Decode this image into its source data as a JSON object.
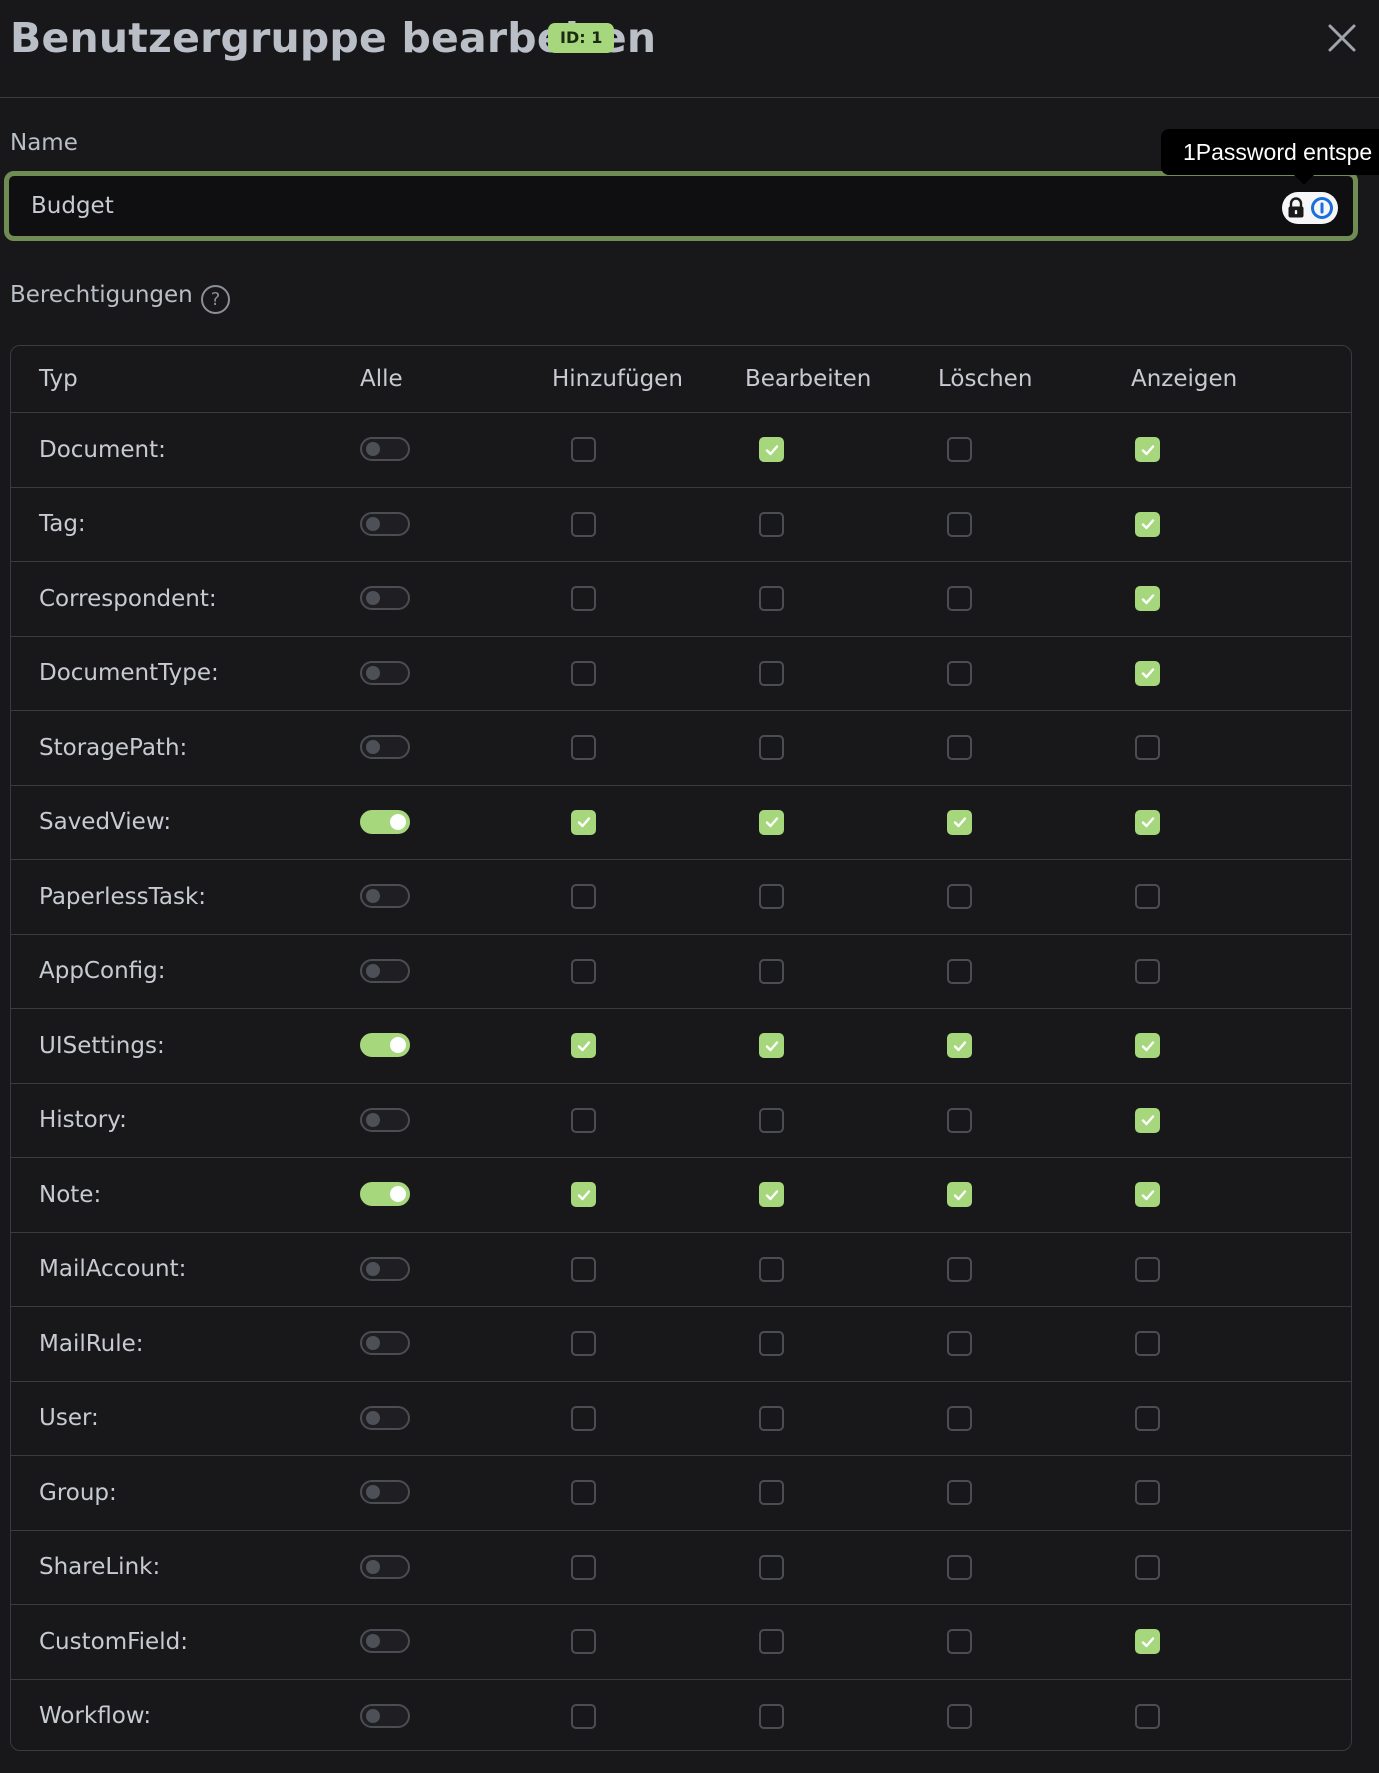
{
  "modal": {
    "title": "Benutzergruppe bearbeiten",
    "id_badge": "ID: 1"
  },
  "name_field": {
    "label": "Name",
    "value": "Budget"
  },
  "password_manager": {
    "tooltip": "1Password entspe"
  },
  "permissions": {
    "label": "Berechtigungen",
    "help_glyph": "?",
    "columns": [
      "Typ",
      "Alle",
      "Hinzufügen",
      "Bearbeiten",
      "Löschen",
      "Anzeigen"
    ],
    "rows": [
      {
        "type": "Document:",
        "all": false,
        "add": false,
        "change": true,
        "delete": false,
        "view": true
      },
      {
        "type": "Tag:",
        "all": false,
        "add": false,
        "change": false,
        "delete": false,
        "view": true
      },
      {
        "type": "Correspondent:",
        "all": false,
        "add": false,
        "change": false,
        "delete": false,
        "view": true
      },
      {
        "type": "DocumentType:",
        "all": false,
        "add": false,
        "change": false,
        "delete": false,
        "view": true
      },
      {
        "type": "StoragePath:",
        "all": false,
        "add": false,
        "change": false,
        "delete": false,
        "view": false
      },
      {
        "type": "SavedView:",
        "all": true,
        "add": true,
        "change": true,
        "delete": true,
        "view": true
      },
      {
        "type": "PaperlessTask:",
        "all": false,
        "add": false,
        "change": false,
        "delete": false,
        "view": false
      },
      {
        "type": "AppConfig:",
        "all": false,
        "add": false,
        "change": false,
        "delete": false,
        "view": false
      },
      {
        "type": "UISettings:",
        "all": true,
        "add": true,
        "change": true,
        "delete": true,
        "view": true
      },
      {
        "type": "History:",
        "all": false,
        "add": false,
        "change": false,
        "delete": false,
        "view": true
      },
      {
        "type": "Note:",
        "all": true,
        "add": true,
        "change": true,
        "delete": true,
        "view": true
      },
      {
        "type": "MailAccount:",
        "all": false,
        "add": false,
        "change": false,
        "delete": false,
        "view": false
      },
      {
        "type": "MailRule:",
        "all": false,
        "add": false,
        "change": false,
        "delete": false,
        "view": false
      },
      {
        "type": "User:",
        "all": false,
        "add": false,
        "change": false,
        "delete": false,
        "view": false
      },
      {
        "type": "Group:",
        "all": false,
        "add": false,
        "change": false,
        "delete": false,
        "view": false
      },
      {
        "type": "ShareLink:",
        "all": false,
        "add": false,
        "change": false,
        "delete": false,
        "view": false
      },
      {
        "type": "CustomField:",
        "all": false,
        "add": false,
        "change": false,
        "delete": false,
        "view": true
      },
      {
        "type": "Workflow:",
        "all": false,
        "add": false,
        "change": false,
        "delete": false,
        "view": false
      }
    ]
  },
  "colors": {
    "accent": "#a6d77c",
    "background": "#18181b",
    "border": "#3a3a3f",
    "focus_border": "#6f8c55"
  }
}
